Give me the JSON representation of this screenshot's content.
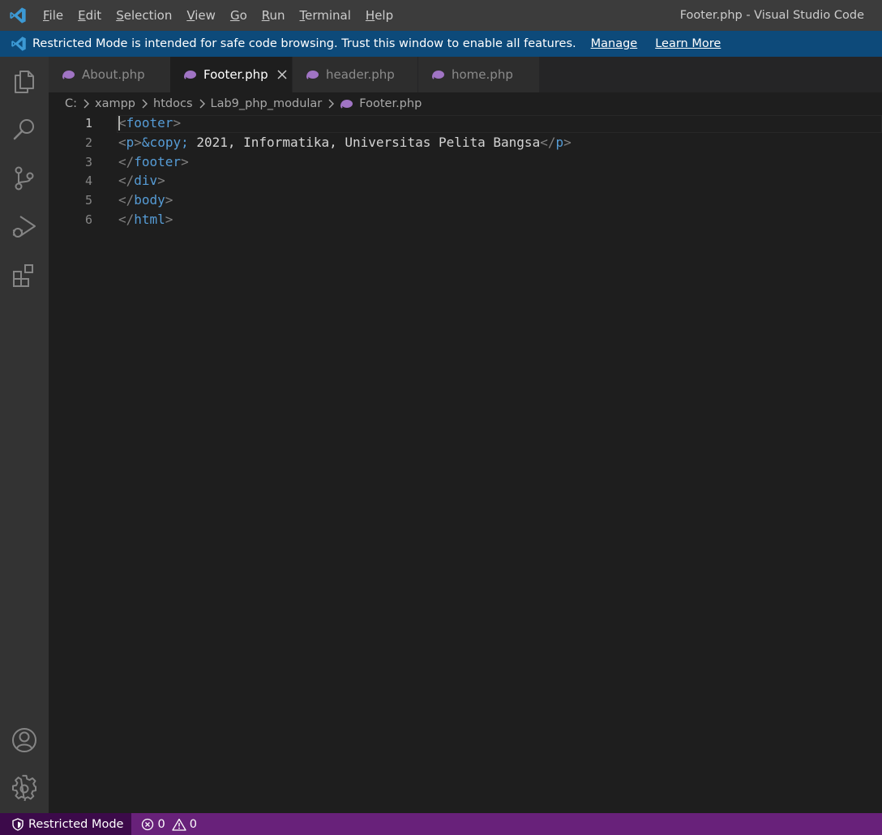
{
  "window": {
    "title": "Footer.php - Visual Studio Code"
  },
  "menu": {
    "items": [
      {
        "mnemonic": "F",
        "rest": "ile"
      },
      {
        "mnemonic": "E",
        "rest": "dit"
      },
      {
        "mnemonic": "S",
        "rest": "election"
      },
      {
        "mnemonic": "V",
        "rest": "iew"
      },
      {
        "mnemonic": "G",
        "rest": "o"
      },
      {
        "mnemonic": "R",
        "rest": "un"
      },
      {
        "mnemonic": "T",
        "rest": "erminal"
      },
      {
        "mnemonic": "H",
        "rest": "elp"
      }
    ]
  },
  "banner": {
    "text": "Restricted Mode is intended for safe code browsing. Trust this window to enable all features.",
    "manage": "Manage",
    "learn_more": "Learn More"
  },
  "activity_bar": {
    "icons": [
      "explorer-icon",
      "search-icon",
      "source-control-icon",
      "run-debug-icon",
      "extensions-icon",
      "accounts-icon",
      "settings-gear-icon"
    ]
  },
  "tabs": [
    {
      "label": "About.php",
      "active": false
    },
    {
      "label": "Footer.php",
      "active": true
    },
    {
      "label": "header.php",
      "active": false
    },
    {
      "label": "home.php",
      "active": false
    }
  ],
  "breadcrumb": {
    "parts": [
      "C:",
      "xampp",
      "htdocs",
      "Lab9_php_modular",
      "Footer.php"
    ]
  },
  "editor": {
    "lines": [
      {
        "num": "1",
        "open": "<",
        "tag": "footer",
        "close": ">"
      },
      {
        "num": "2",
        "p_open_a": "<",
        "p_tag": "p",
        "p_open_b": ">",
        "entity": "&copy;",
        "text": " 2021, Informatika, Universitas Pelita Bangsa",
        "p_close_a": "</",
        "p_close_tag": "p",
        "p_close_b": ">"
      },
      {
        "num": "3",
        "open": "</",
        "tag": "footer",
        "close": ">"
      },
      {
        "num": "4",
        "open": "</",
        "tag": "div",
        "close": ">"
      },
      {
        "num": "5",
        "open": "</",
        "tag": "body",
        "close": ">"
      },
      {
        "num": "6",
        "open": "</",
        "tag": "html",
        "close": ">"
      }
    ]
  },
  "statusbar": {
    "restricted": "Restricted Mode",
    "errors": "0",
    "warnings": "0"
  },
  "colors": {
    "titlebar": "#3c3c3c",
    "banner": "#0d4a7a",
    "statusbar": "#68217a",
    "tag": "#569cd6",
    "php_icon": "#a074c4"
  }
}
